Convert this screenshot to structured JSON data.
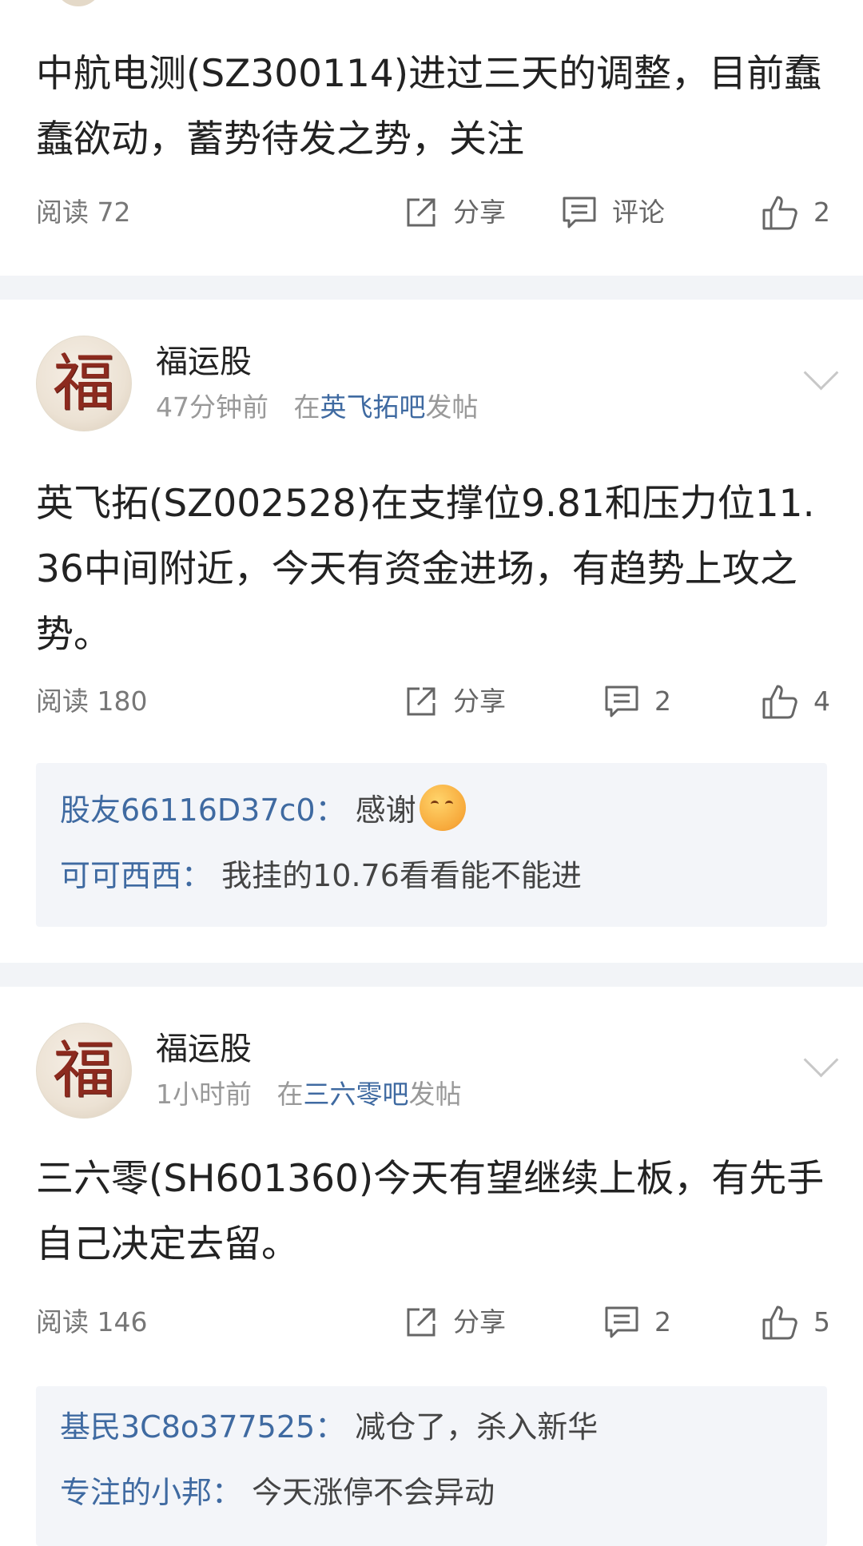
{
  "posts": [
    {
      "content": "中航电测(SZ300114)进过三天的调整，目前蠢蠢欲动，蓄势待发之势，关注",
      "reads": "阅读 72",
      "share_label": "分享",
      "comment_label": "评论",
      "likes": "2"
    },
    {
      "avatar_char": "福",
      "username": "福运股",
      "time": "47分钟前",
      "prefix": "在",
      "bar": "英飞拓吧",
      "suffix": "发帖",
      "content": "英飞拓(SZ002528)在支撑位9.81和压力位11.36中间附近，今天有资金进场，有趋势上攻之势。",
      "reads": "阅读 180",
      "share_label": "分享",
      "comments": "2",
      "likes": "4",
      "replies": [
        {
          "name": "股友66116D37c0：",
          "text": "感谢",
          "emoji": "pray-emoji"
        },
        {
          "name": "可可西西：",
          "text": "我挂的10.76看看能不能进"
        }
      ]
    },
    {
      "avatar_char": "福",
      "username": "福运股",
      "time": "1小时前",
      "prefix": "在",
      "bar": "三六零吧",
      "suffix": "发帖",
      "content": "三六零(SH601360)今天有望继续上板，有先手自己决定去留。",
      "reads": "阅读 146",
      "share_label": "分享",
      "comments": "2",
      "likes": "5",
      "replies": [
        {
          "name": "基民3C8o377525：",
          "text": "减仓了，杀入新华"
        },
        {
          "name": "专注的小邦：",
          "text": "今天涨停不会异动"
        }
      ]
    }
  ],
  "colors": {
    "link": "#3f6aa1",
    "divider": "#f2f4f7",
    "reply_bg": "#f3f5f9"
  }
}
